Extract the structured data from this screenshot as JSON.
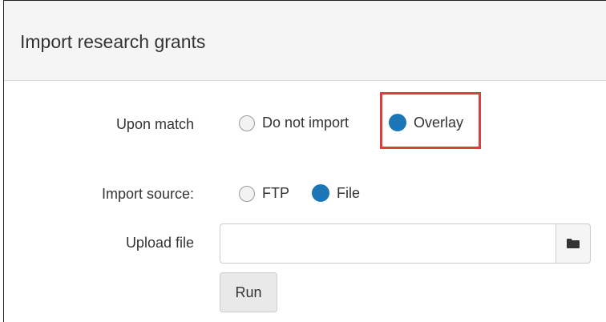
{
  "header": {
    "title": "Import research grants"
  },
  "upon_match": {
    "label": "Upon match",
    "options": [
      {
        "label": "Do not import",
        "selected": false
      },
      {
        "label": "Overlay",
        "selected": true
      }
    ]
  },
  "import_source": {
    "label": "Import source:",
    "options": [
      {
        "label": "FTP",
        "selected": false
      },
      {
        "label": "File",
        "selected": true
      }
    ]
  },
  "upload": {
    "label": "Upload file",
    "value": "",
    "browse_icon": "folder-icon"
  },
  "actions": {
    "run_label": "Run"
  },
  "colors": {
    "radio_selected": "#1a76b6",
    "highlight": "#d9403b",
    "header_bg": "#f5f5f5"
  }
}
